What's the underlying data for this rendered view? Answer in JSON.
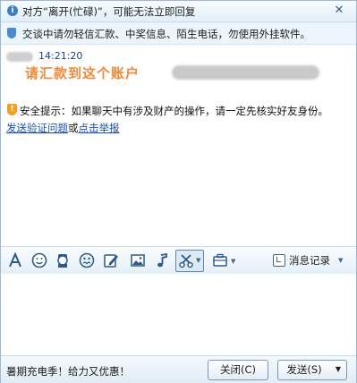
{
  "notices": {
    "status_text": "对方“离开(忙碌)”，可能无法立即回复",
    "warning_text": "交谈中请勿轻信汇款、中奖信息、陌生电话，勿使用外挂软件。"
  },
  "chat": {
    "message_time": "14:21:20",
    "message_text": "请汇款到这个账户",
    "safety_text": "安全提示：如果聊天中有涉及财产的操作，请一定先核实好友身份。",
    "link_verify": "发送验证问题",
    "link_or": "或",
    "link_report": "点击举报"
  },
  "toolbar": {
    "history_label": "消息记录"
  },
  "bottom": {
    "promo_text": "暑期充电季！给力又优惠！",
    "close_label": "关闭(C)",
    "send_label": "发送(S)"
  },
  "icons": [
    "font-icon",
    "emoji-icon",
    "avatar-icon",
    "shake-icon",
    "edit-icon",
    "image-icon",
    "music-icon",
    "scissors-icon",
    "screenshot-icon",
    "history-icon"
  ]
}
